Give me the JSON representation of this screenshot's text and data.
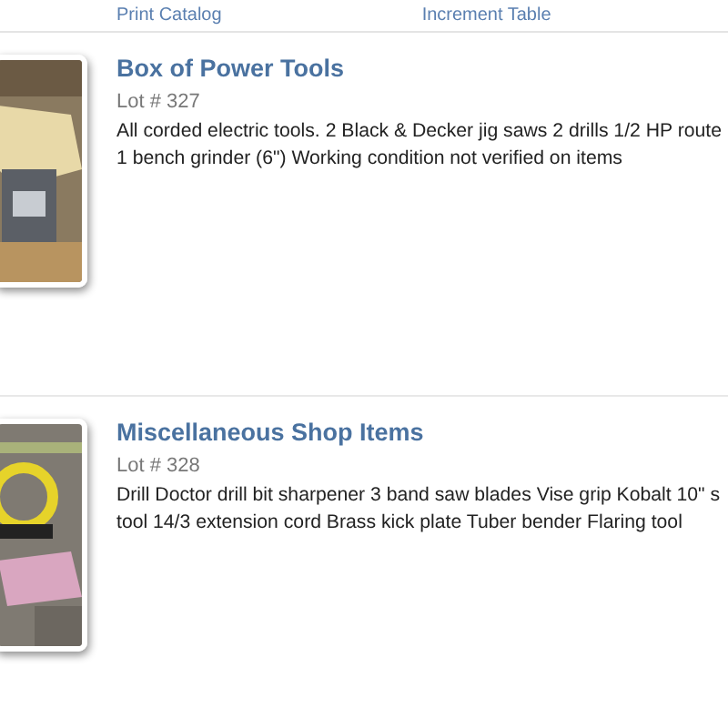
{
  "links": [
    {
      "label": "Print Catalog"
    },
    {
      "label": "Increment Table"
    }
  ],
  "lots": [
    {
      "title": "Box of Power Tools",
      "lot": "Lot # 327",
      "description": [
        "All corded electric tools. 2 Black & Decker jig saws 2 drills 1/2 HP route",
        "1 bench grinder (6\") Working condition not verified on items"
      ]
    },
    {
      "title": "Miscellaneous Shop Items",
      "lot": "Lot # 328",
      "description": [
        "Drill Doctor drill bit sharpener 3 band saw blades Vise grip Kobalt 10\" s",
        "tool 14/3 extension cord Brass kick plate Tuber bender Flaring tool"
      ]
    }
  ]
}
